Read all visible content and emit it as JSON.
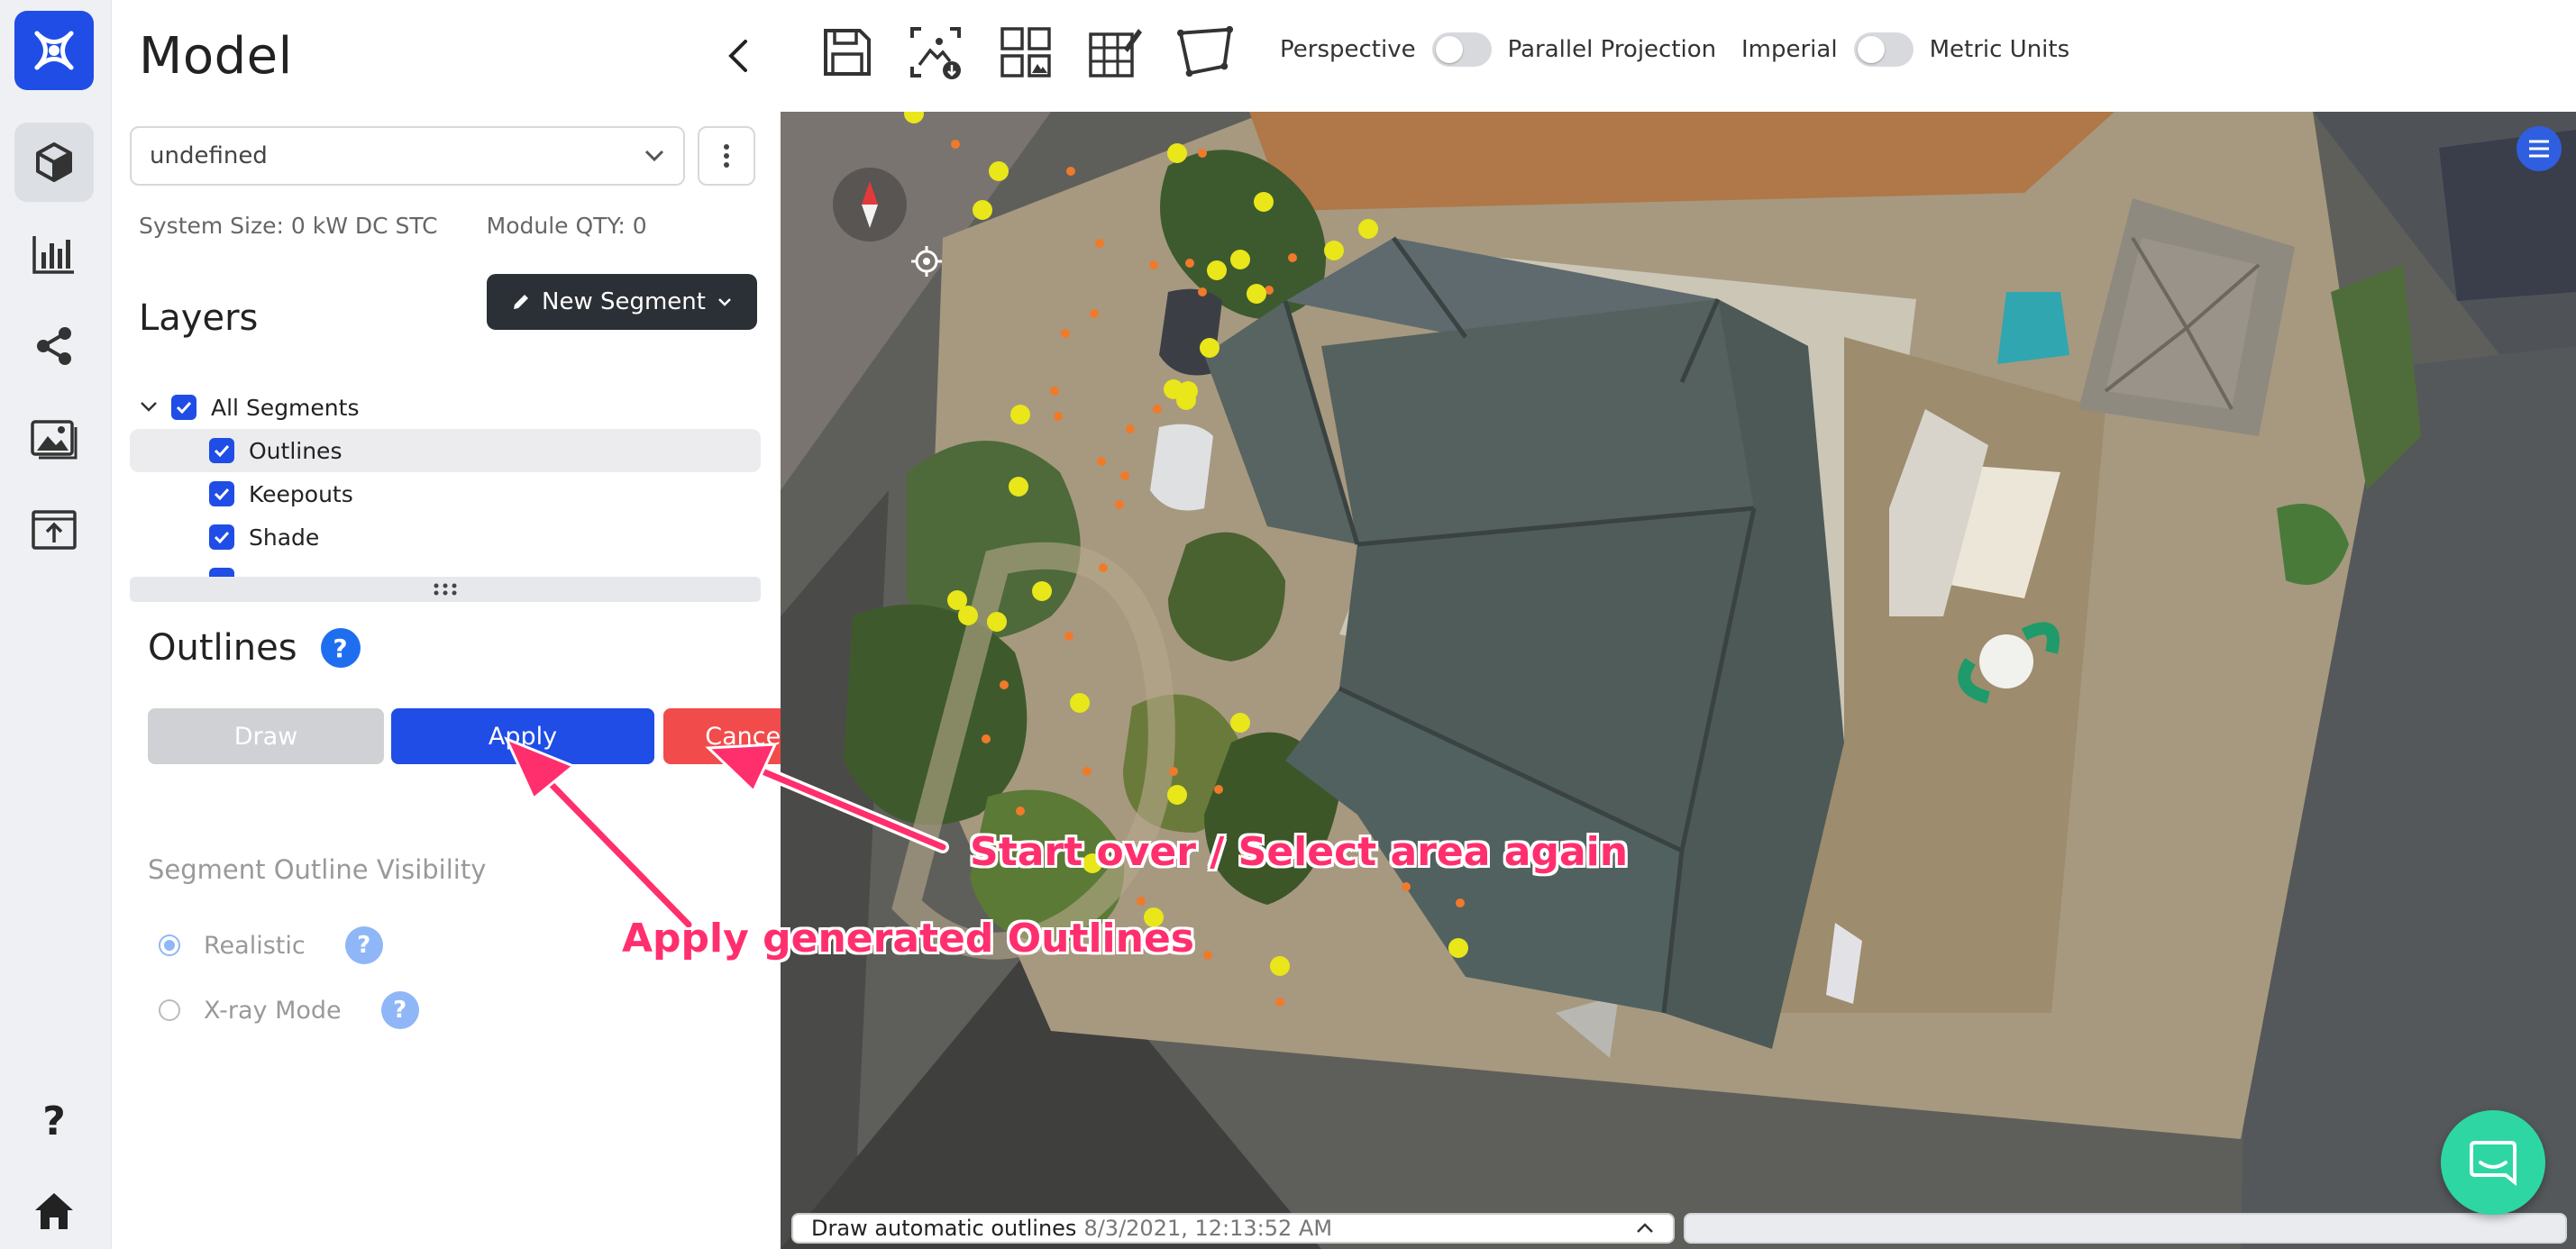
{
  "rail": {
    "logo": "app-logo",
    "items": [
      {
        "icon": "cube-icon",
        "active": true
      },
      {
        "icon": "bar-chart-icon",
        "active": false
      },
      {
        "icon": "share-icon",
        "active": false
      },
      {
        "icon": "image-gallery-icon",
        "active": false
      },
      {
        "icon": "upload-icon",
        "active": false
      }
    ],
    "help_label": "?",
    "home_icon": "home-icon"
  },
  "panel": {
    "title": "Model",
    "design_select_value": "undefined",
    "system_size": "System Size: 0 kW DC STC",
    "module_qty": "Module QTY: 0",
    "layers_heading": "Layers",
    "new_segment_label": "New Segment",
    "tree": [
      {
        "label": "All Segments",
        "checked": true,
        "level": 0
      },
      {
        "label": "Outlines",
        "checked": true,
        "level": 1,
        "selected": true
      },
      {
        "label": "Keepouts",
        "checked": true,
        "level": 1
      },
      {
        "label": "Shade",
        "checked": true,
        "level": 1
      }
    ],
    "outlines_heading": "Outlines",
    "help_label": "?",
    "draw_label": "Draw",
    "apply_label": "Apply",
    "cancel_label": "Cancel",
    "visibility_heading": "Segment Outline Visibility",
    "visibility_options": [
      {
        "label": "Realistic",
        "selected": true
      },
      {
        "label": "X-ray Mode",
        "selected": false
      }
    ]
  },
  "toolbar": {
    "icons": [
      "save-icon",
      "screenshot-download-icon",
      "layout-grid-icon",
      "grid-edit-icon",
      "perspective-box-icon"
    ],
    "projection_left": "Perspective",
    "projection_right": "Parallel Projection",
    "units_left": "Imperial",
    "units_right": "Metric Units"
  },
  "status": {
    "message": "Draw automatic outlines",
    "timestamp": "8/3/2021, 12:13:52 AM"
  },
  "annotations": {
    "cancel_note": "Start over / Select area again",
    "apply_note": "Apply generated Outlines"
  },
  "colors": {
    "accent": "#1f4de6",
    "cancel": "#f24b4b",
    "annotation": "#ff2f6e",
    "chat": "#2ed6a3",
    "vertex": "#e9e61a",
    "edge_point": "#f07a2a"
  }
}
